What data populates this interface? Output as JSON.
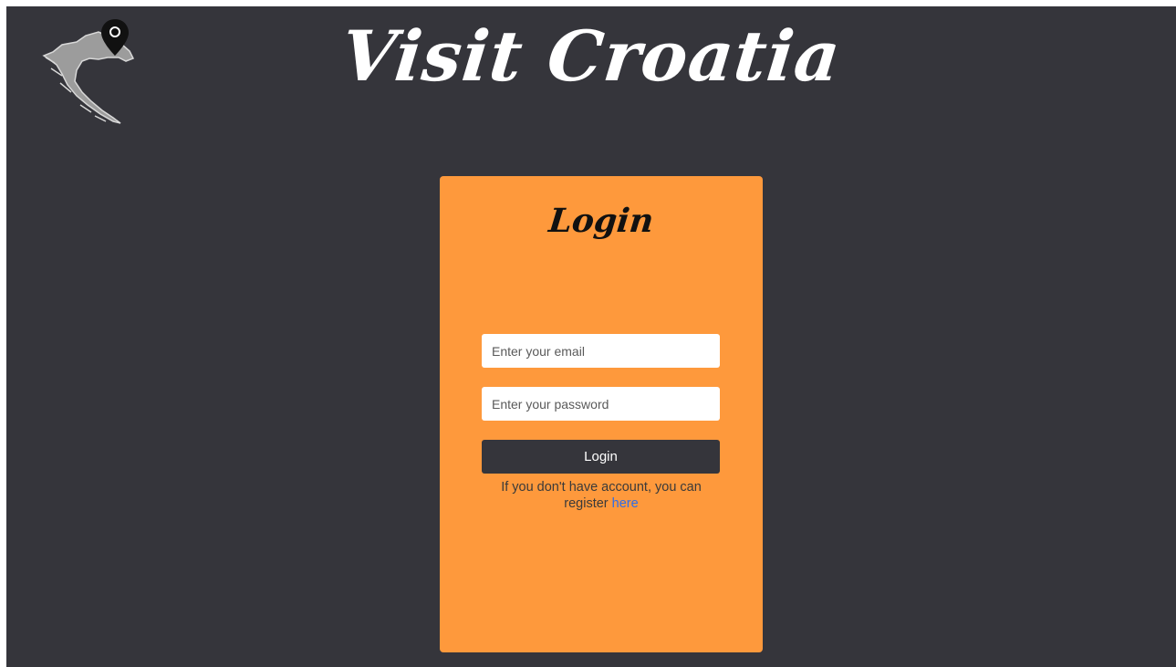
{
  "header": {
    "title": "Visit Croatia",
    "logo_icon": "croatia-map-pin-icon"
  },
  "login": {
    "title": "Login",
    "email_placeholder": "Enter your email",
    "password_placeholder": "Enter your password",
    "button_label": "Login",
    "help_text": "If you don't have account, you can register",
    "register_link": "here"
  },
  "colors": {
    "background": "#35353b",
    "card": "#fe993c",
    "button": "#35353b",
    "link": "#2f6ee8"
  }
}
